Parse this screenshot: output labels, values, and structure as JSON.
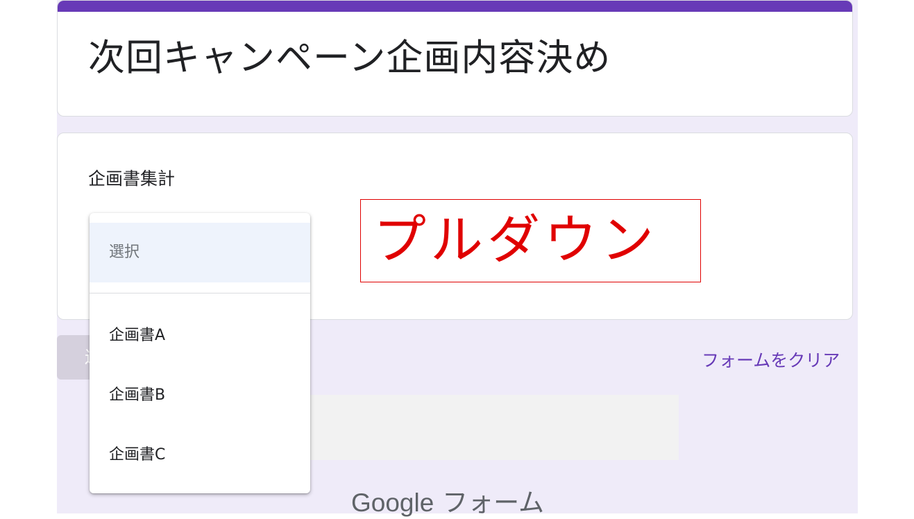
{
  "form": {
    "title": "次回キャンペーン企画内容決め",
    "question_label": "企画書集計",
    "submit_label": "送",
    "clear_label": "フォームをクリア"
  },
  "dropdown": {
    "selected": "選択",
    "options": [
      "企画書A",
      "企画書B",
      "企画書C"
    ]
  },
  "annotation": {
    "text": "プルダウン"
  },
  "footer": {
    "brand": "Google",
    "product": "フォーム"
  },
  "colors": {
    "accent": "#673ab7",
    "background": "#efebf9",
    "annotation": "#e00000"
  }
}
